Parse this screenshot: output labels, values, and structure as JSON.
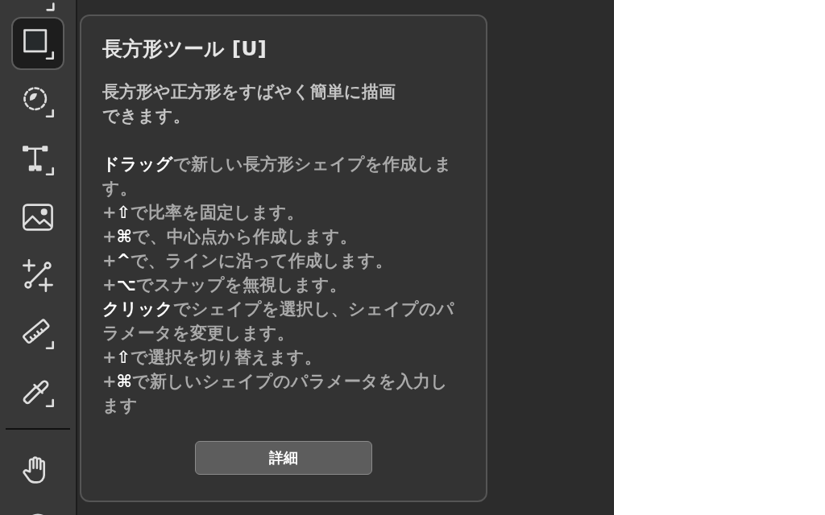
{
  "toolbar": {
    "groups": [
      {
        "tools": [
          {
            "kind": "cut-top",
            "selected": false
          },
          {
            "kind": "rectangle",
            "selected": true
          },
          {
            "kind": "lasso",
            "selected": false
          },
          {
            "kind": "text-frame",
            "selected": false
          },
          {
            "kind": "image",
            "selected": false
          },
          {
            "kind": "line",
            "selected": false
          },
          {
            "kind": "ruler",
            "selected": false
          },
          {
            "kind": "eyedropper",
            "selected": false
          }
        ]
      },
      {
        "tools": [
          {
            "kind": "hand",
            "selected": false
          },
          {
            "kind": "cut-circle",
            "selected": false
          }
        ]
      }
    ]
  },
  "tooltip": {
    "title": "長方形ツール [U]",
    "description": "長方形や正方形をすばやく簡単に描画できます。",
    "instructions": [
      "**ドラッグ**で新しい長方形シェイプを作成します。",
      "+**⇧**で比率を固定します。",
      "+**⌘**で、中心点から作成します。",
      "+**^**で、ラインに沿って作成します。",
      "+**⌥**でスナップを無視します。",
      "**クリック**でシェイプを選択し、シェイプのパラメータを変更します。",
      "+**⇧**で選択を切り替えます。",
      "+**⌘**で新しいシェイプのパラメータを入力します"
    ],
    "button": "詳細"
  }
}
